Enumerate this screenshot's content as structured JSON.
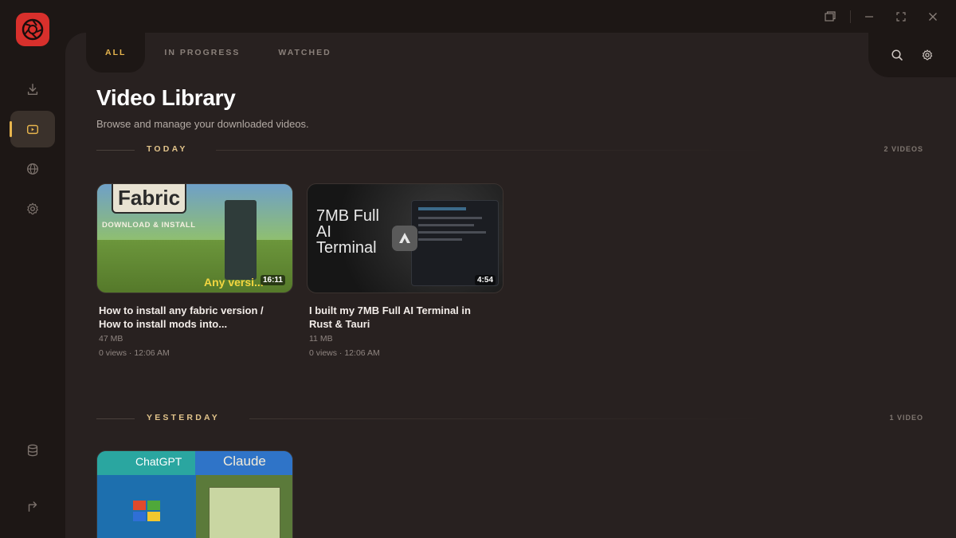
{
  "app": {
    "accent": "#e7b54d",
    "brand": "#d8302c"
  },
  "sidebar": {
    "items": [
      {
        "name": "downloads",
        "icon": "download-icon"
      },
      {
        "name": "library",
        "icon": "play-icon",
        "active": true
      },
      {
        "name": "browser",
        "icon": "globe-icon"
      },
      {
        "name": "settings",
        "icon": "gear-icon"
      },
      {
        "name": "storage",
        "icon": "database-icon"
      },
      {
        "name": "logout",
        "icon": "exit-arrow-icon"
      }
    ]
  },
  "tabs": [
    {
      "label": "ALL",
      "active": true
    },
    {
      "label": "IN PROGRESS",
      "active": false
    },
    {
      "label": "WATCHED",
      "active": false
    }
  ],
  "header": {
    "title": "Video Library",
    "subtitle": "Browse and manage your downloaded videos."
  },
  "sections": [
    {
      "label": "TODAY",
      "count": "2 VIDEOS",
      "videos": [
        {
          "title": "How to install any fabric version / How to install mods into...",
          "size": "47 MB",
          "meta": "0 views · 12:06 AM",
          "duration": "16:11",
          "thumb_text": {
            "big": "Fabric",
            "small": "DOWNLOAD & INSTALL",
            "corner": "Any versi..."
          }
        },
        {
          "title": "I built my 7MB Full AI Terminal in Rust & Tauri",
          "size": "11 MB",
          "meta": "0 views · 12:06 AM",
          "duration": "4:54",
          "thumb_text": {
            "line1": "7MB Full",
            "line2": "AI",
            "line3": "Terminal"
          }
        }
      ]
    },
    {
      "label": "YESTERDAY",
      "count": "1 VIDEO",
      "videos": [
        {
          "thumb_text": {
            "left": "ChatGPT",
            "right": "Claude"
          }
        }
      ]
    }
  ]
}
